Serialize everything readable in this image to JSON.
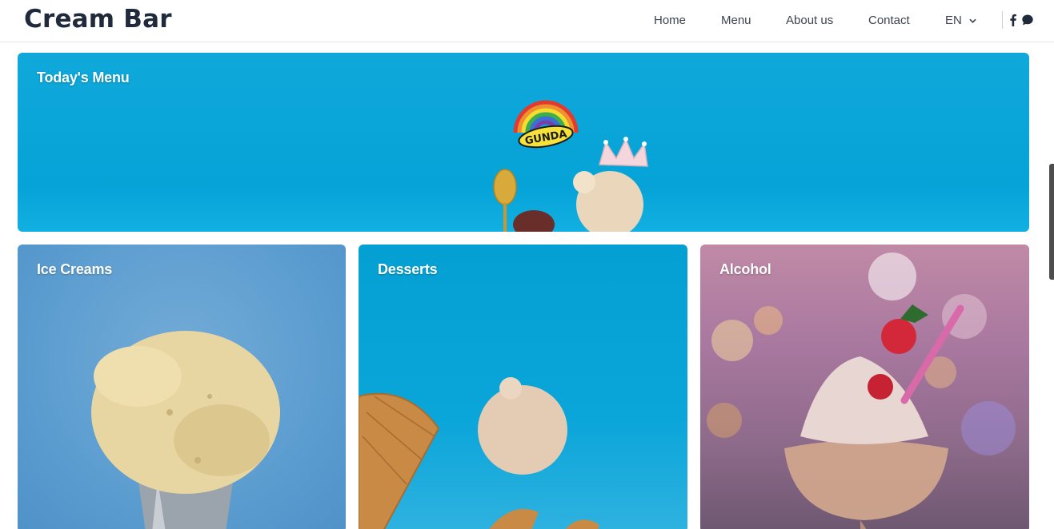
{
  "header": {
    "brand": "Cream Bar",
    "nav": [
      {
        "label": "Home"
      },
      {
        "label": "Menu"
      },
      {
        "label": "About us"
      },
      {
        "label": "Contact"
      }
    ],
    "language": "EN",
    "social": [
      {
        "icon": "facebook-icon"
      },
      {
        "icon": "chat-bubble-icon"
      }
    ]
  },
  "hero": {
    "title": "Today's Menu",
    "logo_text": "GUNDA"
  },
  "categories": [
    {
      "title": "Ice Creams"
    },
    {
      "title": "Desserts"
    },
    {
      "title": "Alcohol"
    }
  ],
  "colors": {
    "brand_text": "#1f2a3c",
    "hero_blue": "#05a3d7",
    "icecream_blue": "#5c9dd0",
    "dessert_blue": "#0aa5d9"
  }
}
